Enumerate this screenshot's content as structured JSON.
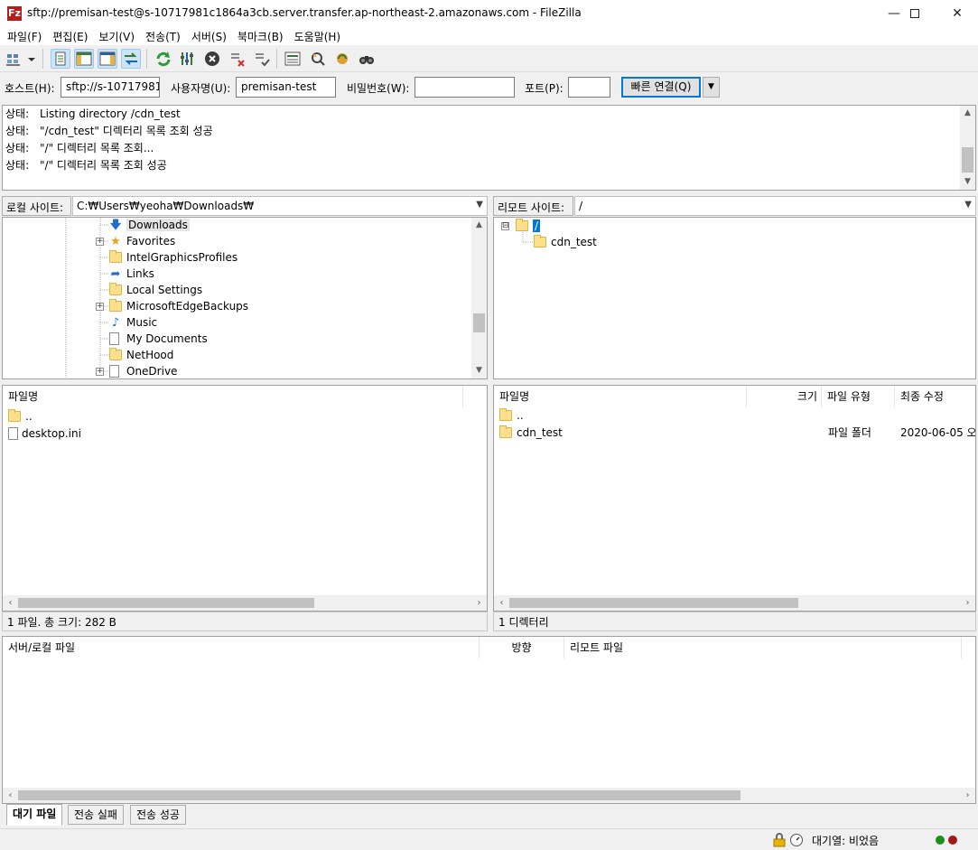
{
  "window": {
    "title": "sftp://premisan-test@s-10717981c1864a3cb.server.transfer.ap-northeast-2.amazonaws.com - FileZilla",
    "app_icon": "Fz",
    "minimize": "—",
    "maximize": "☐",
    "close": "✕"
  },
  "menu": [
    {
      "label": "파일(F)"
    },
    {
      "label": "편집(E)"
    },
    {
      "label": "보기(V)"
    },
    {
      "label": "전송(T)"
    },
    {
      "label": "서버(S)"
    },
    {
      "label": "북마크(B)"
    },
    {
      "label": "도움말(H)"
    }
  ],
  "toolbar_icons": [
    "site-manager-icon",
    "site-manager-dropdown-icon",
    "message-log-toggle-icon",
    "local-tree-toggle-icon",
    "remote-tree-toggle-icon",
    "transfer-queue-toggle-icon",
    "refresh-icon",
    "process-queue-icon",
    "cancel-icon",
    "disconnect-icon",
    "reconnect-icon",
    "directory-listing-filter-icon",
    "compare-icon",
    "sync-browse-icon",
    "find-files-icon"
  ],
  "quickconnect": {
    "host_label": "호스트(H):",
    "host_value": "sftp://s-10717981c",
    "user_label": "사용자명(U):",
    "user_value": "premisan-test",
    "pass_label": "비밀번호(W):",
    "pass_value": "",
    "port_label": "포트(P):",
    "port_value": "",
    "connect_label": "빠른 연결(Q)",
    "dropdown": "▼"
  },
  "log": [
    {
      "kind": "상태:",
      "text": "Listing directory /cdn_test"
    },
    {
      "kind": "상태:",
      "text": "\"/cdn_test\" 디렉터리 목록 조회 성공"
    },
    {
      "kind": "상태:",
      "text": "\"/\" 디렉터리 목록 조회..."
    },
    {
      "kind": "상태:",
      "text": "\"/\" 디렉터리 목록 조회 성공"
    }
  ],
  "local": {
    "site_label": "로컬 사이트:",
    "path": "C:₩Users₩yeoha₩Downloads₩",
    "tree": [
      {
        "name": "Downloads",
        "icon": "download-arrow",
        "expandable": false,
        "selected": true
      },
      {
        "name": "Favorites",
        "icon": "star",
        "expandable": true
      },
      {
        "name": "IntelGraphicsProfiles",
        "icon": "folder",
        "expandable": false
      },
      {
        "name": "Links",
        "icon": "link-arrow",
        "expandable": false
      },
      {
        "name": "Local Settings",
        "icon": "folder",
        "expandable": false
      },
      {
        "name": "MicrosoftEdgeBackups",
        "icon": "folder",
        "expandable": true
      },
      {
        "name": "Music",
        "icon": "music-note",
        "expandable": false
      },
      {
        "name": "My Documents",
        "icon": "document",
        "expandable": false
      },
      {
        "name": "NetHood",
        "icon": "folder",
        "expandable": false
      },
      {
        "name": "OneDrive",
        "icon": "file",
        "expandable": true
      }
    ],
    "columns": {
      "name": "파일명"
    },
    "files": [
      {
        "name": "..",
        "type": "folder"
      },
      {
        "name": "desktop.ini",
        "type": "file"
      }
    ],
    "status": "1 파일. 총 크기: 282 B"
  },
  "remote": {
    "site_label": "리모트 사이트:",
    "path": "/",
    "tree_root": "/",
    "tree_child": "cdn_test",
    "tree_collapse": "⊟",
    "columns": {
      "name": "파일명",
      "size": "크기",
      "type": "파일 유형",
      "modified": "최종 수정"
    },
    "files": [
      {
        "name": "..",
        "size": "",
        "type": "",
        "modified": ""
      },
      {
        "name": "cdn_test",
        "size": "",
        "type": "파일 폴더",
        "modified": "2020-06-05 오..."
      }
    ],
    "status": "1 디렉터리"
  },
  "queue": {
    "col_server_local": "서버/로컬 파일",
    "col_direction": "방향",
    "col_remote": "리모트 파일"
  },
  "tabs": [
    {
      "label": "대기 파일",
      "active": true
    },
    {
      "label": "전송 실패",
      "active": false
    },
    {
      "label": "전송 성공",
      "active": false
    }
  ],
  "statusbar": {
    "queue_text": "대기열: 비었음"
  }
}
